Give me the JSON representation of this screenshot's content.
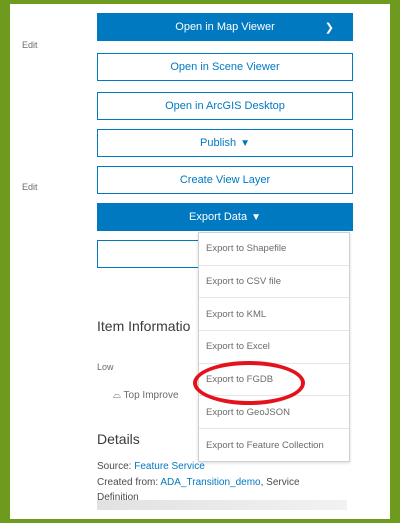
{
  "edit_labels": [
    "Edit",
    "Edit"
  ],
  "buttons": {
    "map_viewer": "Open in Map Viewer",
    "scene_viewer": "Open in Scene Viewer",
    "arcgis_desktop": "Open in ArcGIS Desktop",
    "publish": "Publish",
    "create_view_layer": "Create View Layer",
    "export_data": "Export Data"
  },
  "export_menu": [
    "Export to Shapefile",
    "Export to CSV file",
    "Export to KML",
    "Export to Excel",
    "Export to FGDB",
    "Export to GeoJSON",
    "Export to Feature Collection"
  ],
  "item_information": {
    "title": "Item Informatio",
    "level": "Low",
    "improve_link": "Top Improve"
  },
  "details": {
    "title": "Details",
    "source_label": "Source:",
    "source_value": "Feature Service",
    "created_from_label": "Created from:",
    "created_from_value": "ADA_Transition_demo",
    "created_from_suffix": ", Service",
    "definition": "Definition"
  },
  "colors": {
    "accent": "#0079c1",
    "frame": "#6e9a1e",
    "highlight": "#e3121b"
  }
}
